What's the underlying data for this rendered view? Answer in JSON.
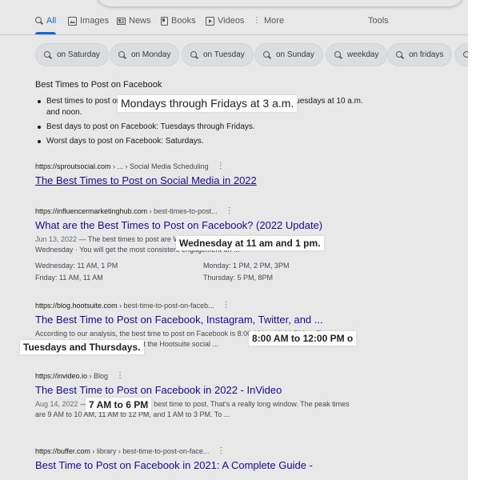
{
  "tabs": [
    {
      "label": "All",
      "icon": "search-icon",
      "active": true
    },
    {
      "label": "Images",
      "icon": "image-icon"
    },
    {
      "label": "News",
      "icon": "news-icon"
    },
    {
      "label": "Books",
      "icon": "book-icon"
    },
    {
      "label": "Videos",
      "icon": "video-icon"
    },
    {
      "label": "More",
      "icon": "more-vert-icon"
    },
    {
      "label": "Tools"
    }
  ],
  "chips": [
    "on Saturday",
    "on Monday",
    "on Tuesday",
    "on Sunday",
    "weekday",
    "on fridays"
  ],
  "featured": {
    "title": "Best Times to Post on Facebook",
    "bullets": [
      "Best times to post on Facebook: Mondays through Fridays at 3 a.m., Tuesdays at 10 a.m. and noon.",
      "Best days to post on Facebook: Tuesdays through Fridays.",
      "Worst days to post on Facebook: Saturdays."
    ]
  },
  "results": [
    {
      "url": "https://sproutsocial.com",
      "path": " › ... › Social Media Scheduling",
      "title": "The Best Times to Post on Social Media in 2022"
    },
    {
      "url": "https://influencermarketinghub.com",
      "path": " › best-times-to-post...",
      "title": "What are the Best Times to Post on Facebook? (2022 Update)",
      "date": "Jun 13, 2022",
      "snippet": " — The best times to post are Wednesday at 11 am and 1 pm. Best day is Wednesday · You will get the most consistent engagement on ...",
      "table": [
        [
          "Wednesday: 11 AM, 1 PM",
          "Monday: 1 PM, 2 PM, 3PM"
        ],
        [
          "Friday: 11 AM, 11 AM",
          "Thursday: 5 PM, 8PM"
        ]
      ]
    },
    {
      "url": "https://blog.hootsuite.com",
      "path": " › best-time-to-post-on-faceb...",
      "title": "The Best Time to Post on Facebook, Instagram, Twitter, and ...",
      "snippet": "According to our analysis, the best time to post on Facebook is 8:00 AM to 12:00 PM on Tuesdays and Thursdays. ... backs with what the Hootsuite social ..."
    },
    {
      "url": "https://invideo.io",
      "path": " › Blog",
      "title": "The Best Time to Post on Facebook in 2022 - InVideo",
      "date": "Aug 14, 2022",
      "snippet": " — 7 AM to 6 PM is the best time to post. That's a really long window. The peak times are 9 AM to 10 AM, 11 AM to 12 PM, and 1 AM to 3 PM. To ..."
    },
    {
      "url": "https://buffer.com",
      "path": " › library › best-time-to-post-on-face...",
      "title": "Best Time to Post on Facebook in 2021: A Complete Guide -"
    }
  ],
  "callouts": [
    "Mondays through Fridays at 3 a.m.",
    "Wednesday at 11 am and 1 pm.",
    "8:00 AM to 12:00 PM o",
    "Tuesdays and Thursdays.",
    "7 AM to 6 PM"
  ],
  "colors": {
    "link": "#1a0dab",
    "accent": "#1a73e8",
    "text": "#202124",
    "muted": "#4d5156"
  }
}
